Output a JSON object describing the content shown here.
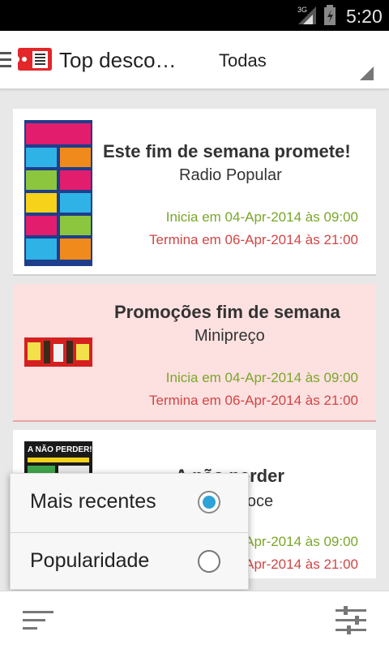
{
  "status_bar": {
    "network": "3G",
    "time": "5:20"
  },
  "action_bar": {
    "title": "Top desco…",
    "filter_value": "Todas",
    "icons": [
      "menu-icon",
      "app-logo-icon",
      "dropdown-arrow-icon"
    ]
  },
  "cards": [
    {
      "title": "Este fim de semana promete!",
      "store": "Radio Popular",
      "start": "Inicia em 04-Apr-2014 às 09:00",
      "end": "Termina em 06-Apr-2014 às 21:00"
    },
    {
      "title": "Promoções fim de semana",
      "store": "Minipreço",
      "start": "Inicia em 04-Apr-2014 às 09:00",
      "end": "Termina em 06-Apr-2014 às 21:00"
    },
    {
      "title": "A não perder",
      "store": "Jumboce",
      "start": "Inicia em 04-Apr-2014 às 09:00",
      "end": "Termina em 06-Apr-2014 às 21:00",
      "thumb_text": "A NÃO PERDER!"
    }
  ],
  "sort_menu": {
    "options": [
      {
        "label": "Mais recentes",
        "selected": true
      },
      {
        "label": "Popularidade",
        "selected": false
      }
    ]
  },
  "bottom_bar": {
    "icons": [
      "sort-icon",
      "filter-settings-icon"
    ]
  },
  "colors": {
    "accent": "#2ea3d8",
    "start_text": "#7aa62a",
    "end_text": "#d24545",
    "highlight_card": "#fde0e0"
  }
}
